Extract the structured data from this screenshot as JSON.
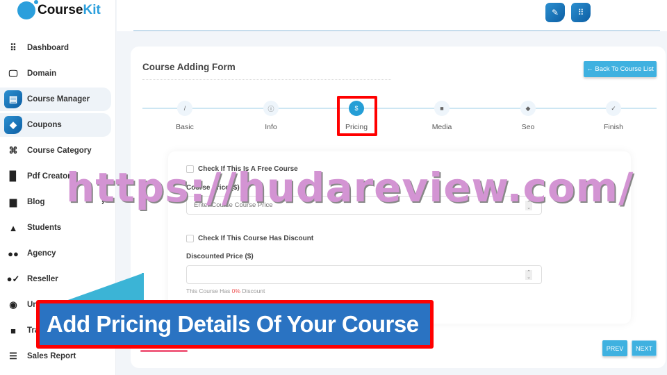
{
  "brand": {
    "name_a": "Course",
    "name_b": "Kit"
  },
  "sidebar": {
    "items": [
      {
        "label": "Dashboard",
        "icon": "grid-icon",
        "glyph": "⠿"
      },
      {
        "label": "Domain",
        "icon": "monitor-icon",
        "glyph": "🖵"
      },
      {
        "label": "Course Manager",
        "icon": "inbox-icon",
        "glyph": "▤",
        "active": true
      },
      {
        "label": "Coupons",
        "icon": "ticket-icon",
        "glyph": "◆",
        "active": true
      },
      {
        "label": "Course Category",
        "icon": "command-icon",
        "glyph": "⌘"
      },
      {
        "label": "Pdf Creator",
        "icon": "pdf-file-icon",
        "glyph": "▉"
      },
      {
        "label": "Blog",
        "icon": "calendar-icon",
        "glyph": "▆",
        "chevron": "›"
      },
      {
        "label": "Students",
        "icon": "graduation-cap-icon",
        "glyph": "▲"
      },
      {
        "label": "Agency",
        "icon": "users-icon",
        "glyph": "●●"
      },
      {
        "label": "Reseller",
        "icon": "user-check-icon",
        "glyph": "●✓"
      },
      {
        "label": "Un",
        "icon": "lifebuoy-icon",
        "glyph": "◉"
      },
      {
        "label": "Tra",
        "icon": "video-icon",
        "glyph": "■"
      },
      {
        "label": "Sales Report",
        "icon": "clipboard-icon",
        "glyph": "☰"
      }
    ]
  },
  "topbar": {
    "buttons": [
      {
        "icon": "magic-wand-icon",
        "glyph": "✎"
      },
      {
        "icon": "apps-grid-icon",
        "glyph": "⠿"
      }
    ]
  },
  "form": {
    "title": "Course Adding Form",
    "back_label": "← Back To Course List",
    "steps": [
      {
        "label": "Basic",
        "icon": "pencil-icon",
        "glyph": "/"
      },
      {
        "label": "Info",
        "icon": "info-icon",
        "glyph": "ⓘ"
      },
      {
        "label": "Pricing",
        "icon": "dollar-icon",
        "glyph": "$",
        "active": true
      },
      {
        "label": "Media",
        "icon": "video-icon",
        "glyph": "■"
      },
      {
        "label": "Seo",
        "icon": "tag-icon",
        "glyph": "◆"
      },
      {
        "label": "Finish",
        "icon": "check-circle-icon",
        "glyph": "✓"
      }
    ],
    "free_checkbox": "Check If This Is A Free Course",
    "price_label": "Course Price ($)",
    "price_placeholder": "Enter Course Course Price",
    "price_value": "",
    "discount_checkbox": "Check If This Course Has Discount",
    "discounted_label": "Discounted Price ($)",
    "discounted_value": "",
    "hint_a": "This Course Has ",
    "hint_pct": "0%",
    "hint_b": " Discount",
    "prev": "PREV",
    "next": "NEXT"
  },
  "overlay": {
    "watermark": "https://hudareview.com/",
    "banner": "Add Pricing Details Of Your Course"
  },
  "colors": {
    "accent": "#259ed6",
    "button": "#3fb1e0",
    "banner": "#2a73c2",
    "highlight": "#ff0000",
    "watermark": "#d394d3"
  }
}
